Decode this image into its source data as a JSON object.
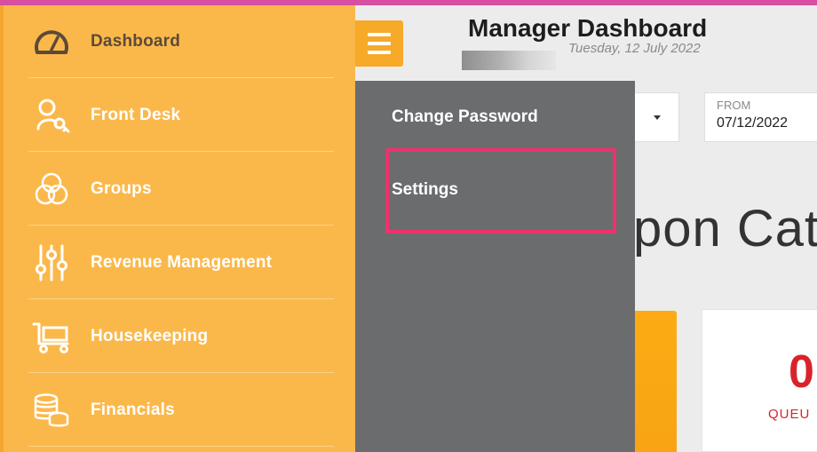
{
  "header": {
    "title": "Manager Dashboard",
    "date": "Tuesday, 12 July 2022"
  },
  "sidebar": {
    "items": [
      {
        "label": "Dashboard",
        "icon": "speedometer-icon"
      },
      {
        "label": "Front Desk",
        "icon": "person-key-icon"
      },
      {
        "label": "Groups",
        "icon": "groups-circles-icon"
      },
      {
        "label": "Revenue Management",
        "icon": "sliders-icon"
      },
      {
        "label": "Housekeeping",
        "icon": "cart-icon"
      },
      {
        "label": "Financials",
        "icon": "coins-icon"
      }
    ]
  },
  "dropdown": {
    "items": [
      {
        "label": "Change Password"
      },
      {
        "label": "Settings"
      }
    ]
  },
  "filters": {
    "from_label": "FROM",
    "from_value": "07/12/2022"
  },
  "main": {
    "heading": "pon Cate",
    "stat_value": "0",
    "stat_label": "QUEU"
  },
  "colors": {
    "sidebar_bg": "#fbb84a",
    "dropdown_bg": "#6b6c6e",
    "highlight": "#f0316e",
    "accent": "#f7a928",
    "stat_red": "#d9232b"
  }
}
